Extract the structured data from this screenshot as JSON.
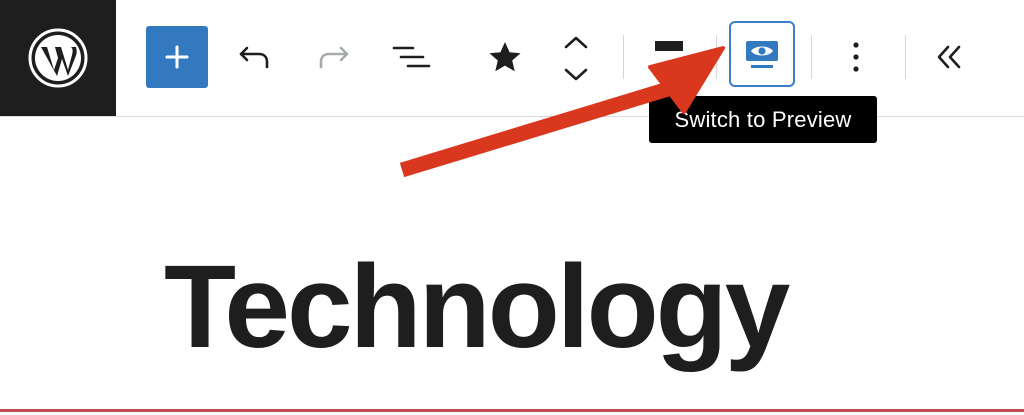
{
  "toolbar": {
    "logo_icon": "wordpress-logo-icon",
    "add_block_icon": "plus-icon",
    "undo_icon": "undo-icon",
    "redo_icon": "redo-icon",
    "document_overview_icon": "list-view-icon",
    "favorite_icon": "star-icon",
    "move_icon": "chevron-up-down-icon",
    "preview_icon": "preview-eye-icon",
    "options_icon": "more-vertical-icon",
    "collapse_icon": "double-chevron-left-icon"
  },
  "tooltip": {
    "text": "Switch to Preview"
  },
  "content": {
    "heading": "Technology"
  },
  "colors": {
    "accent_blue": "#3379c0",
    "preview_border": "#3d7ec6",
    "annotation_arrow": "#d9381e",
    "dark": "#1e1e1e"
  }
}
